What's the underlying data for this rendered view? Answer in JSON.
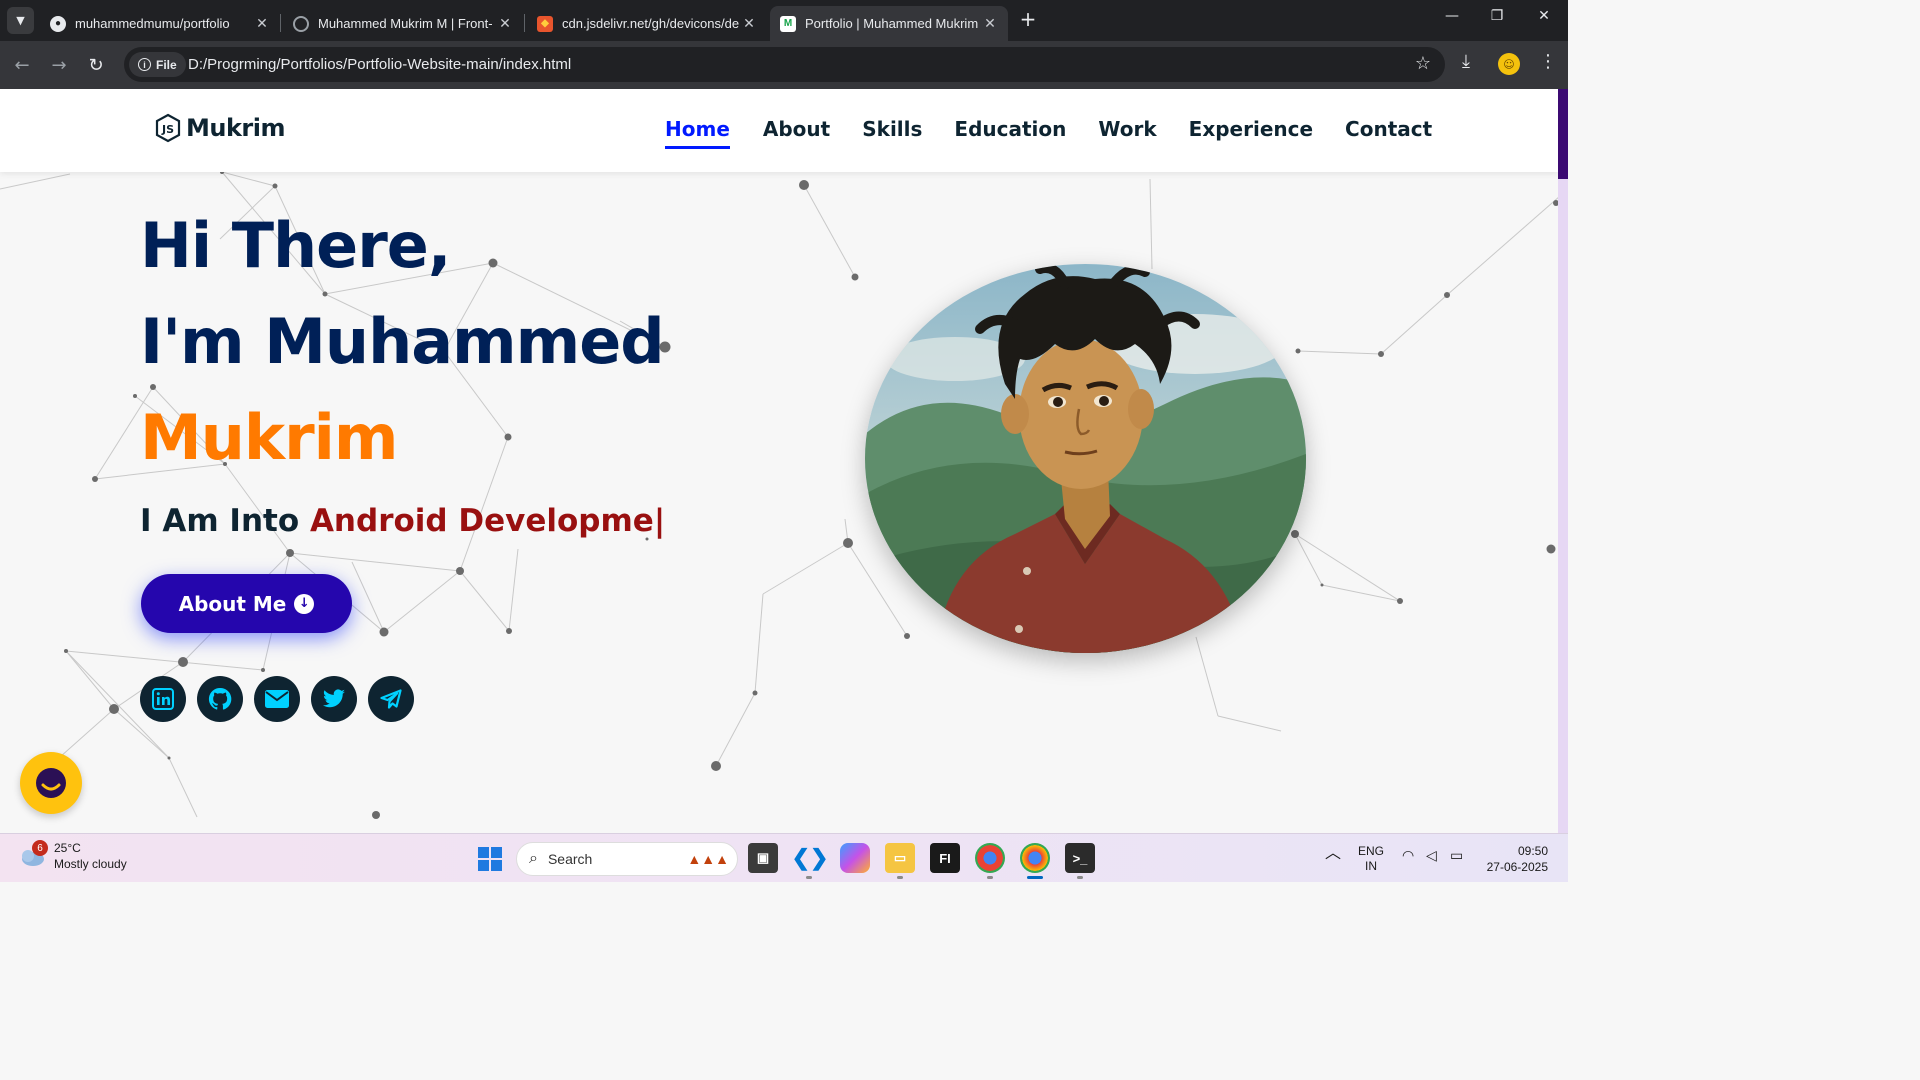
{
  "browser": {
    "tabs": [
      {
        "title": "muhammedmumu/portfolio",
        "icon": "github-icon"
      },
      {
        "title": "Muhammed Mukrim M | Front-",
        "icon": "globe-icon"
      },
      {
        "title": "cdn.jsdelivr.net/gh/devicons/de",
        "icon": "shield-icon"
      },
      {
        "title": "Portfolio | Muhammed Mukrim",
        "icon": "portfolio-favicon",
        "active": true
      }
    ],
    "address": {
      "scheme_chip": "File",
      "url": "D:/Progrming/Portfolios/Portfolio-Website-main/index.html"
    }
  },
  "site": {
    "logo": "Mukrim",
    "nav": [
      "Home",
      "About",
      "Skills",
      "Education",
      "Work",
      "Experience",
      "Contact"
    ],
    "active_nav": "Home",
    "hero": {
      "line1": "Hi There,",
      "line2": "I'm Muhammed",
      "name": "Mukrim",
      "typing_prefix": "I Am Into",
      "typing_role": "Android Developme|",
      "button": "About Me"
    },
    "socials": [
      "linkedin-icon",
      "github-icon",
      "email-icon",
      "twitter-icon",
      "telegram-icon"
    ],
    "colors": {
      "accent_blue": "#011aff",
      "name_orange": "#ff7a00",
      "heading_navy": "#002057",
      "role_red": "#991010",
      "button": "#2506ad"
    }
  },
  "taskbar": {
    "weather": {
      "badge": "6",
      "temp": "25°C",
      "condition": "Mostly cloudy"
    },
    "search_placeholder": "Search",
    "language": {
      "top": "ENG",
      "bottom": "IN"
    },
    "time": "09:50",
    "date": "27-06-2025"
  }
}
